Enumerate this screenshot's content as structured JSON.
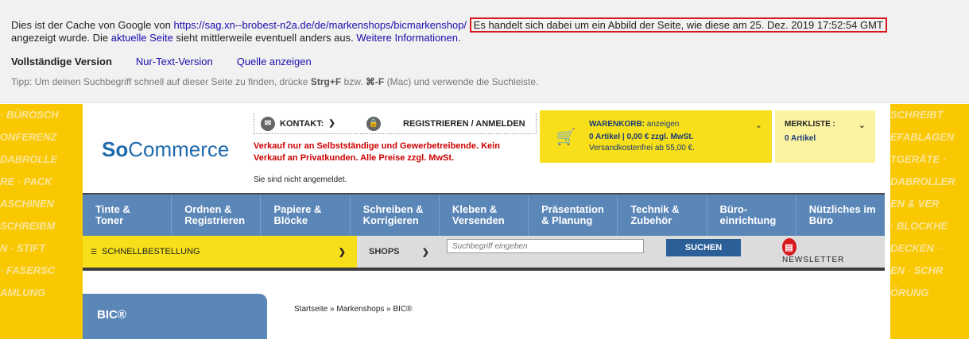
{
  "cache": {
    "prefix": "Dies ist der Cache von Google von ",
    "url": "https://sag.xn--brobest-n2a.de/de/markenshops/bicmarkenshop/",
    "highlight": "Es handelt sich dabei um ein Abbild der Seite, wie diese am 25. Dez. 2019 17:52:54 GMT",
    "line2_a": "angezeigt wurde. Die ",
    "current_page_link": "aktuelle Seite",
    "line2_b": " sieht mittlerweile eventuell anders aus. ",
    "more_info_link": "Weitere Informationen",
    "full_version": "Vollständige Version",
    "text_only": "Nur-Text-Version",
    "view_source": "Quelle anzeigen",
    "tip_a": "Tipp: Um deinen Suchbegriff schnell auf dieser Seite zu finden, drücke ",
    "tip_key1": "Strg+F",
    "tip_b": " bzw. ",
    "tip_key2": "⌘-F",
    "tip_c": " (Mac) und verwende die Suchleiste."
  },
  "side_banner": {
    "left_lines": [
      "· BÜROSCH",
      "ONFERENZ",
      "DABROLLE",
      "RE · PACK",
      "ASCHINEN",
      "SCHREIBM",
      "N · STIFT",
      "· FASERSC",
      "AMLUNG"
    ],
    "right_lines": [
      "SCHREIBT",
      "EFABLAGEN",
      "TGERÄTE ·",
      "DABROLLER",
      "EN & VER",
      "· BLOCKHE",
      "DECKEN ·",
      "EN · SCHR",
      "ÖRUNG"
    ]
  },
  "header": {
    "logo_bold": "So",
    "logo_rest": "Commerce",
    "contact": "KONTAKT:",
    "register": "REGISTRIEREN / ANMELDEN",
    "notice": "Verkauf nur an Selbstständige und Gewerbetreibende. Kein Verkauf an Privatkunden. Alle Preise zzgl. MwSt.",
    "login_state": "Sie sind nicht angemeldet."
  },
  "cart": {
    "title": "WARENKORB:",
    "show": "anzeigen",
    "line1": "0 Artikel | 0,00 € zzgl. MwSt.",
    "line2": "Versandkostenfrei ab 55,00 €."
  },
  "watchlist": {
    "title": "MERKLISTE :",
    "count": "0 Artikel"
  },
  "nav": [
    {
      "l1": "Tinte &",
      "l2": "Toner"
    },
    {
      "l1": "Ordnen &",
      "l2": "Registrieren"
    },
    {
      "l1": "Papiere &",
      "l2": "Blöcke"
    },
    {
      "l1": "Schreiben &",
      "l2": "Korrigieren"
    },
    {
      "l1": "Kleben &",
      "l2": "Versenden"
    },
    {
      "l1": "Präsentation",
      "l2": "& Planung"
    },
    {
      "l1": "Technik &",
      "l2": "Zubehör"
    },
    {
      "l1": "Büro-",
      "l2": "einrichtung"
    },
    {
      "l1": "Nützliches im",
      "l2": "Büro"
    }
  ],
  "subbar": {
    "quick": "SCHNELLBESTELLUNG",
    "shops": "SHOPS",
    "search_placeholder": "Suchbegriff eingeben",
    "search_button": "SUCHEN",
    "newsletter": "NEWSLETTER"
  },
  "content": {
    "brand": "BIC®",
    "breadcrumb": "Startseite » Markenshops » BIC®"
  }
}
